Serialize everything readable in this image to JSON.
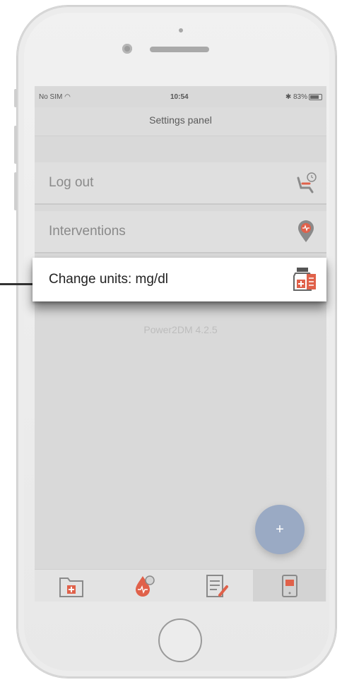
{
  "status_bar": {
    "carrier": "No SIM",
    "time": "10:54",
    "battery": "83%"
  },
  "nav": {
    "title": "Settings panel"
  },
  "rows": [
    {
      "label": "Log out",
      "icon": "seat-clock-icon"
    },
    {
      "label": "Interventions",
      "icon": "location-pin-icon"
    }
  ],
  "highlighted_row": {
    "label": "Change units: mg/dl",
    "icon": "medicine-bottle-icon"
  },
  "version": "Power2DM 4.2.5",
  "fab": {
    "label": "+"
  },
  "tabs": [
    {
      "icon": "medical-folder-icon"
    },
    {
      "icon": "blood-drop-clock-icon"
    },
    {
      "icon": "checklist-pencil-icon"
    },
    {
      "icon": "phone-chat-icon"
    }
  ],
  "colors": {
    "accent": "#e0614a",
    "fab": "#9aaac4",
    "screen_overlay": "#d9d9d9"
  }
}
